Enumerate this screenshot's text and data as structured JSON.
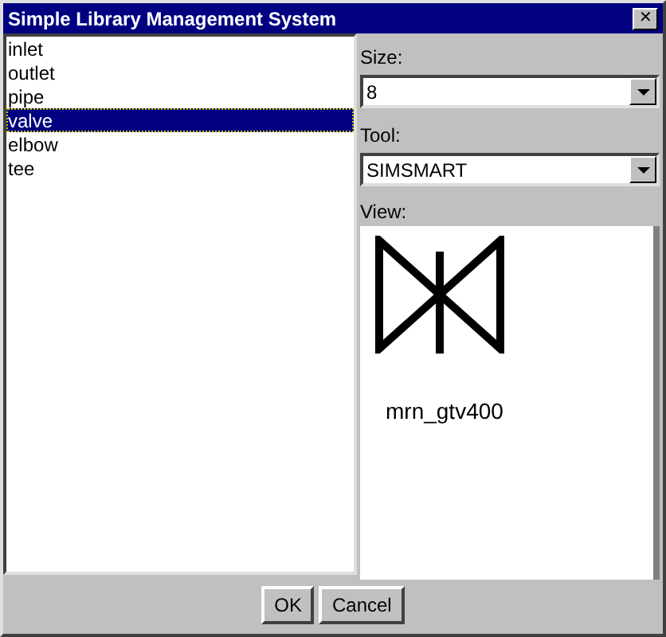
{
  "window": {
    "title": "Simple Library Management System",
    "close": "✕"
  },
  "items": [
    {
      "label": "inlet",
      "selected": false
    },
    {
      "label": "outlet",
      "selected": false
    },
    {
      "label": "pipe",
      "selected": false
    },
    {
      "label": "valve",
      "selected": true
    },
    {
      "label": "elbow",
      "selected": false
    },
    {
      "label": "tee",
      "selected": false
    }
  ],
  "size": {
    "label": "Size:",
    "value": "8"
  },
  "tool": {
    "label": "Tool:",
    "value": "SIMSMART"
  },
  "view": {
    "label": "View:",
    "symbol": "mrn_gtv400"
  },
  "buttons": [
    "OK",
    "Cancel"
  ]
}
